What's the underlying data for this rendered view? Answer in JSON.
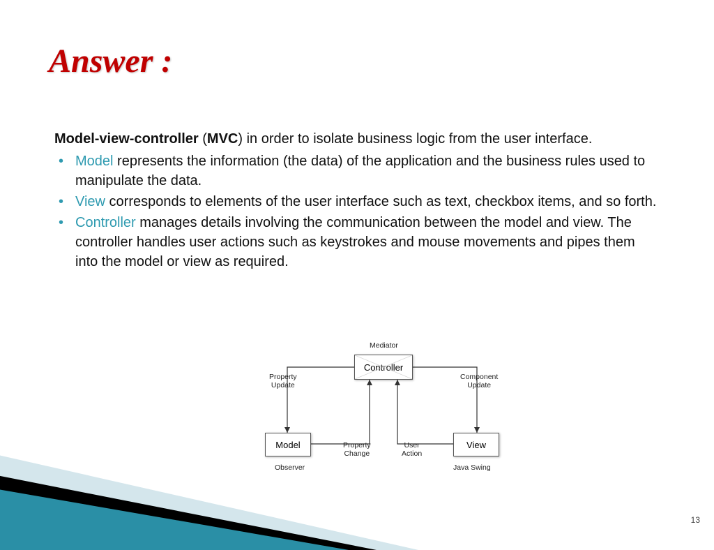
{
  "title": "Answer :",
  "intro": {
    "bold1": "Model-view-controller",
    "mid": " (",
    "bold2": "MVC",
    "rest": ") in order to isolate business logic from the user interface."
  },
  "bullets": [
    {
      "term": "Model",
      "text": " represents the information (the data) of the application and the business rules used to manipulate the data."
    },
    {
      "term": "View",
      "text": " corresponds to elements of the user interface such as text, checkbox items, and so forth."
    },
    {
      "term": "Controller",
      "text": " manages details involving the communication between the model and view. The controller handles user actions such as keystrokes and mouse movements and pipes them into the model or view as required."
    }
  ],
  "diagram": {
    "mediator": "Mediator",
    "controller": "Controller",
    "model": "Model",
    "view": "View",
    "propUpdate": "Property\nUpdate",
    "compUpdate": "Component\nUpdate",
    "propChange": "Property\nChange",
    "userAction": "User\nAction",
    "observer": "Observer",
    "javaSwing": "Java Swing"
  },
  "pageNumber": "13"
}
